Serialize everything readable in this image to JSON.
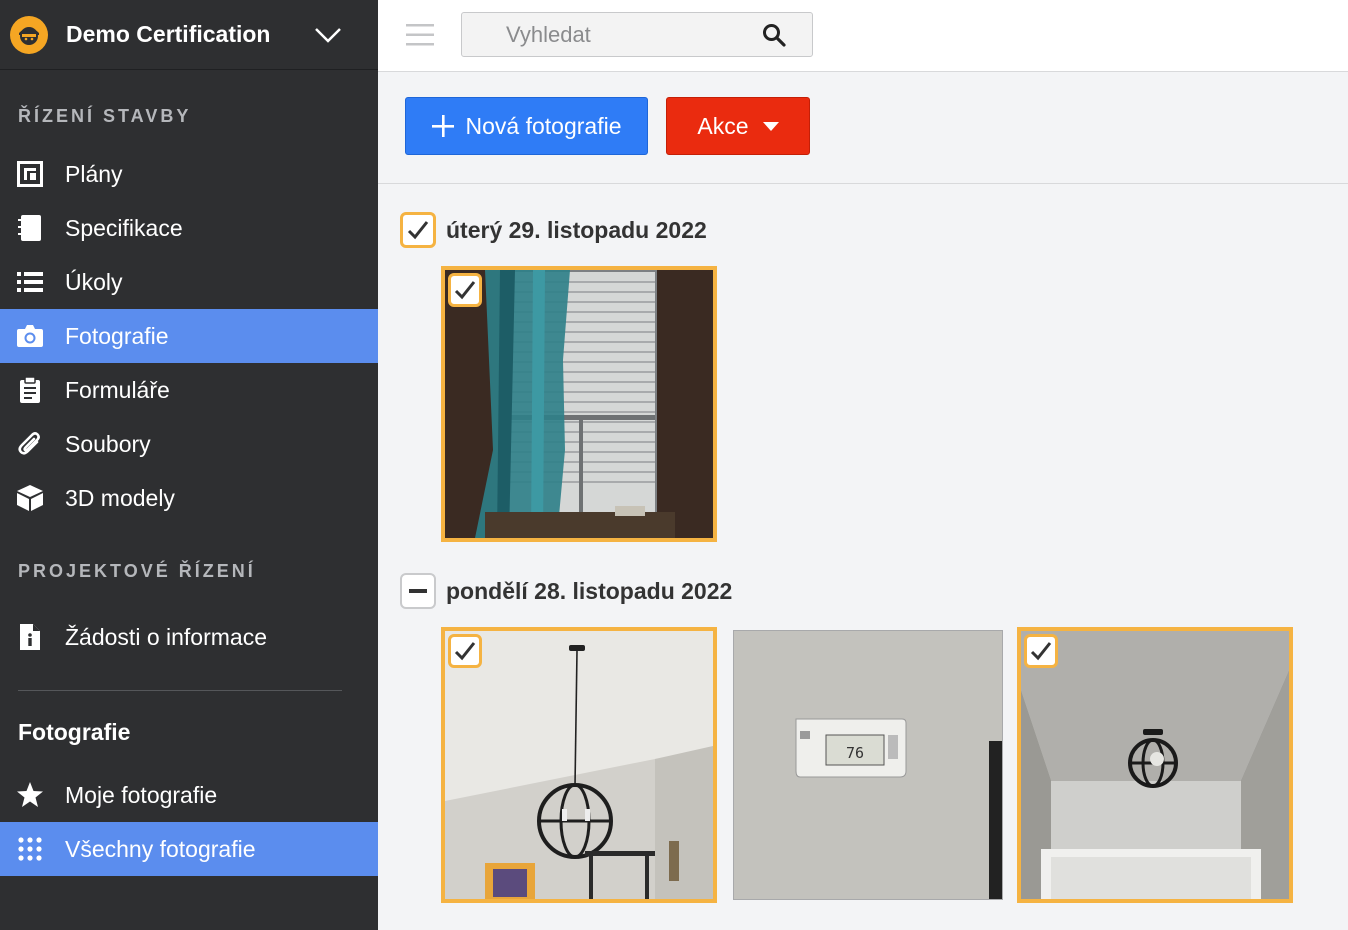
{
  "project": {
    "name": "Demo Certification"
  },
  "sidebar": {
    "section_construction": "ŘÍZENÍ STAVBY",
    "construction_items": [
      {
        "label": "Plány",
        "icon": "plans-icon"
      },
      {
        "label": "Specifikace",
        "icon": "specs-icon"
      },
      {
        "label": "Úkoly",
        "icon": "list-icon"
      },
      {
        "label": "Fotografie",
        "icon": "camera-icon",
        "active": true
      },
      {
        "label": "Formuláře",
        "icon": "clipboard-icon"
      },
      {
        "label": "Soubory",
        "icon": "paperclip-icon"
      },
      {
        "label": "3D modely",
        "icon": "cube-icon"
      }
    ],
    "section_project": "PROJEKTOVÉ ŘÍZENÍ",
    "project_items": [
      {
        "label": "Žádosti o informace",
        "icon": "info-document-icon"
      }
    ],
    "photos_title": "Fotografie",
    "photo_items": [
      {
        "label": "Moje fotografie",
        "icon": "star-icon"
      },
      {
        "label": "Všechny fotografie",
        "icon": "grid-dots-icon",
        "active": true
      }
    ]
  },
  "search": {
    "placeholder": "Vyhledat"
  },
  "toolbar": {
    "new_photo_label": "Nová fotografie",
    "actions_label": "Akce"
  },
  "groups": [
    {
      "date": "úterý 29. listopadu 2022",
      "state": "checked"
    },
    {
      "date": "pondělí 28. listopadu 2022",
      "state": "partial"
    }
  ],
  "photos": {
    "thermostat_reading": "76"
  },
  "colors": {
    "sidebar_bg": "#2e2f31",
    "active_item": "#5b8dee",
    "primary_button": "#2f7cf6",
    "danger_button": "#ea2b0f",
    "selection": "#f5b342"
  }
}
